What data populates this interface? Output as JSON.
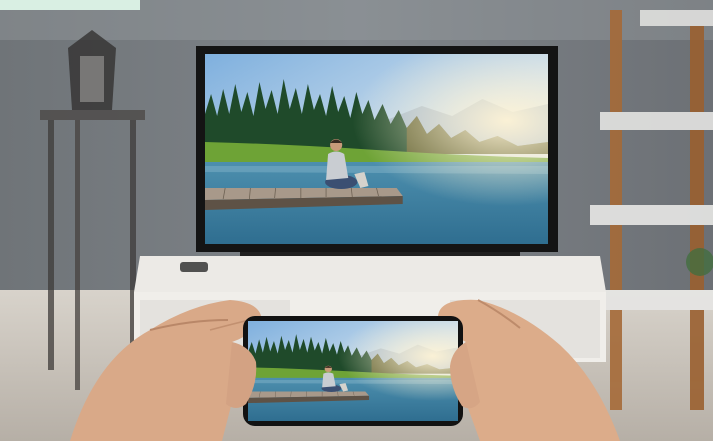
{
  "scene": {
    "colors": {
      "wall": "#7d8185",
      "floor": "#c9c4bc",
      "tv_bezel": "#141414",
      "sky": "#a8c8e6",
      "forest": "#1f4a2a",
      "grass": "#6ea336",
      "lake": "#3f83a6",
      "dock": "#8a7a68",
      "skin": "#d9a988",
      "shelf_wood": "#a56a38"
    }
  }
}
